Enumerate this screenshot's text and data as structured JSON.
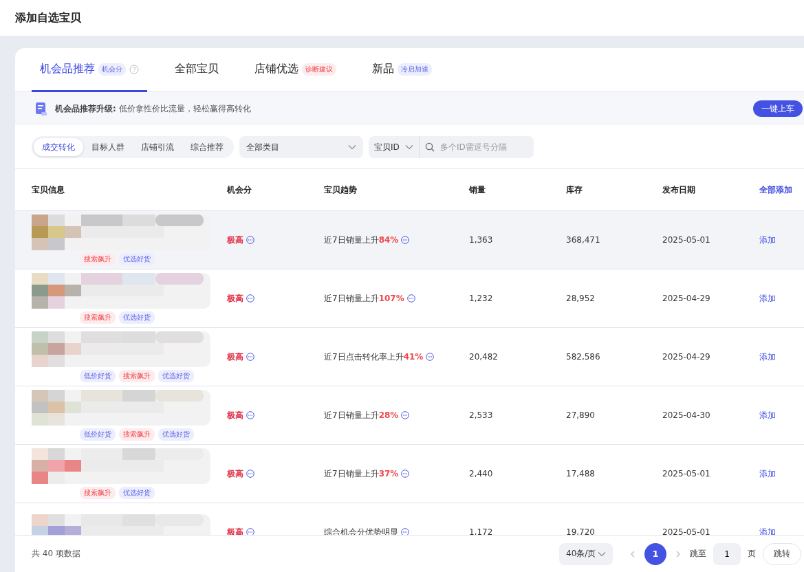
{
  "header": {
    "title": "添加自选宝贝"
  },
  "tabs": [
    {
      "label": "机会品推荐",
      "badge": {
        "label": "机会分",
        "kind": "info"
      },
      "help": true,
      "selected": true
    },
    {
      "label": "全部宝贝",
      "selected": false
    },
    {
      "label": "店铺优选",
      "badge": {
        "label": "诊断建议",
        "kind": "alert"
      },
      "selected": false
    },
    {
      "label": "新品",
      "badge": {
        "label": "冷启加速",
        "kind": "info"
      },
      "selected": false
    }
  ],
  "banner": {
    "title": "机会品推荐升级:",
    "text": "低价拿性价比流量，轻松赢得高转化",
    "button": "一键上车"
  },
  "filters": {
    "segments": [
      {
        "label": "成交转化",
        "selected": true
      },
      {
        "label": "目标人群",
        "selected": false
      },
      {
        "label": "店铺引流",
        "selected": false
      },
      {
        "label": "综合推荐",
        "selected": false
      }
    ],
    "category": "全部类目",
    "id_type": "宝贝ID",
    "search_placeholder": "多个ID需逗号分隔"
  },
  "table": {
    "columns": [
      "宝贝信息",
      "机会分",
      "宝贝趋势",
      "销量",
      "库存",
      "发布日期"
    ],
    "add_all": "全部添加",
    "rows": [
      {
        "product": {
          "kind": "picture"
        },
        "tags": [
          {
            "label": "搜索飙升",
            "kind": "hot"
          },
          {
            "label": "优选好货",
            "kind": "good"
          }
        ],
        "score": "极高",
        "trend": "近7日销量上升",
        "trend_value": "84%",
        "sales": "1,363",
        "stock": "368,471",
        "date": "2025-05-01",
        "action": "添加",
        "hovered": true
      },
      {
        "product": {
          "kind": "picture"
        },
        "tags": [
          {
            "label": "搜索飙升",
            "kind": "hot"
          },
          {
            "label": "优选好货",
            "kind": "good"
          }
        ],
        "score": "极高",
        "trend": "近7日销量上升",
        "trend_value": "107%",
        "sales": "1,232",
        "stock": "28,952",
        "date": "2025-04-29",
        "action": "添加",
        "hovered": false
      },
      {
        "product": {
          "kind": "picture"
        },
        "tags": [
          {
            "label": "低价好货",
            "kind": "good"
          },
          {
            "label": "搜索飙升",
            "kind": "hot"
          },
          {
            "label": "优选好货",
            "kind": "good"
          }
        ],
        "score": "极高",
        "trend": "近7日点击转化率上升",
        "trend_value": "41%",
        "sales": "20,482",
        "stock": "582,586",
        "date": "2025-04-29",
        "action": "添加",
        "hovered": false
      },
      {
        "product": {
          "kind": "picture"
        },
        "tags": [
          {
            "label": "低价好货",
            "kind": "good"
          },
          {
            "label": "搜索飙升",
            "kind": "hot"
          },
          {
            "label": "优选好货",
            "kind": "good"
          }
        ],
        "score": "极高",
        "trend": "近7日销量上升",
        "trend_value": "28%",
        "sales": "2,533",
        "stock": "27,890",
        "date": "2025-04-30",
        "action": "添加",
        "hovered": false
      },
      {
        "product": {
          "kind": "picture"
        },
        "tags": [
          {
            "label": "搜索飙升",
            "kind": "hot"
          },
          {
            "label": "优选好货",
            "kind": "good"
          }
        ],
        "score": "极高",
        "trend": "近7日销量上升",
        "trend_value": "37%",
        "sales": "2,440",
        "stock": "17,488",
        "date": "2025-05-01",
        "action": "添加",
        "hovered": false
      },
      {
        "product": {
          "kind": "picture"
        },
        "tags": [],
        "score": "极高",
        "trend": "综合机会分优势明显",
        "trend_value": "",
        "sales": "1,172",
        "stock": "19,720",
        "date": "2025-05-01",
        "action": "添加",
        "hovered": false
      }
    ]
  },
  "footer": {
    "total": "共 40 项数据",
    "page_size": "40条/页",
    "pages": [
      {
        "label": "1",
        "selected": true
      }
    ],
    "goto_label": "跳至",
    "goto_value": "1",
    "page_unit": "页",
    "goto_button": "跳转"
  }
}
